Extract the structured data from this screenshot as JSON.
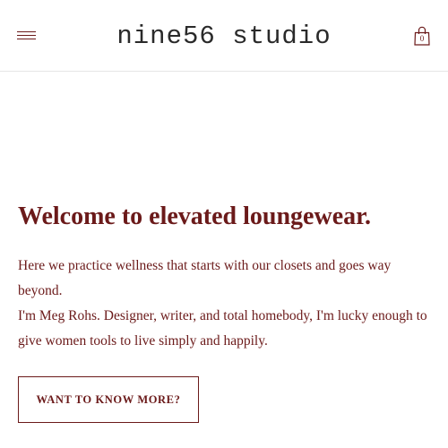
{
  "header": {
    "logo_text": "nine56 studio",
    "menu_icon": "hamburger-menu-icon",
    "cart_icon": "shopping-bag-icon",
    "cart_count": "0"
  },
  "hero": {
    "title": "Welcome to elevated loungewear.",
    "paragraph_1": "Here we practice wellness that starts with our closets and goes way beyond.",
    "paragraph_2": "I'm Meg Rohs.  Designer, writer, and total homebody, I'm lucky enough to give women tools to live simply and happily.",
    "cta_label": "WANT TO KNOW MORE?"
  },
  "colors": {
    "accent": "#6b1a1a",
    "background": "#ffffff",
    "divider": "#e6e6e6"
  }
}
